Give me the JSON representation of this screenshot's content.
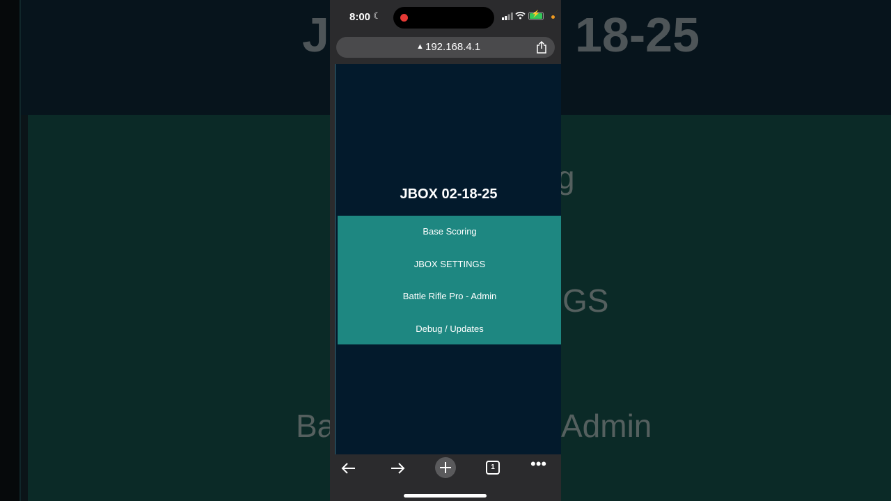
{
  "background": {
    "title_partial": "JB",
    "title_tail": "18-25",
    "frag_1": "g",
    "frag_2": "GS",
    "frag_3": "Ba",
    "frag_4": "Admin"
  },
  "status_bar": {
    "time": "8:00",
    "focus_icon": "moon-icon",
    "recording_icon": "record-dot-icon",
    "signal_icon": "cellular-signal-icon",
    "wifi_icon": "wifi-icon",
    "battery_icon": "battery-charging-icon",
    "battery_color": "#35c759"
  },
  "address_bar": {
    "warning_icon": "warning-triangle-icon",
    "url": "192.168.4.1",
    "share_icon": "share-icon"
  },
  "page": {
    "title": "JBOX 02-18-25",
    "menu": [
      "Base Scoring",
      "JBOX SETTINGS",
      "Battle Rifle Pro - Admin",
      "Debug / Updates"
    ],
    "menu_bg": "#1e8781",
    "page_bg": "#031a2c"
  },
  "toolbar": {
    "back_icon": "back-arrow-icon",
    "forward_icon": "forward-arrow-icon",
    "new_tab_icon": "plus-icon",
    "tab_count": "1",
    "more_icon": "more-dots-icon"
  }
}
